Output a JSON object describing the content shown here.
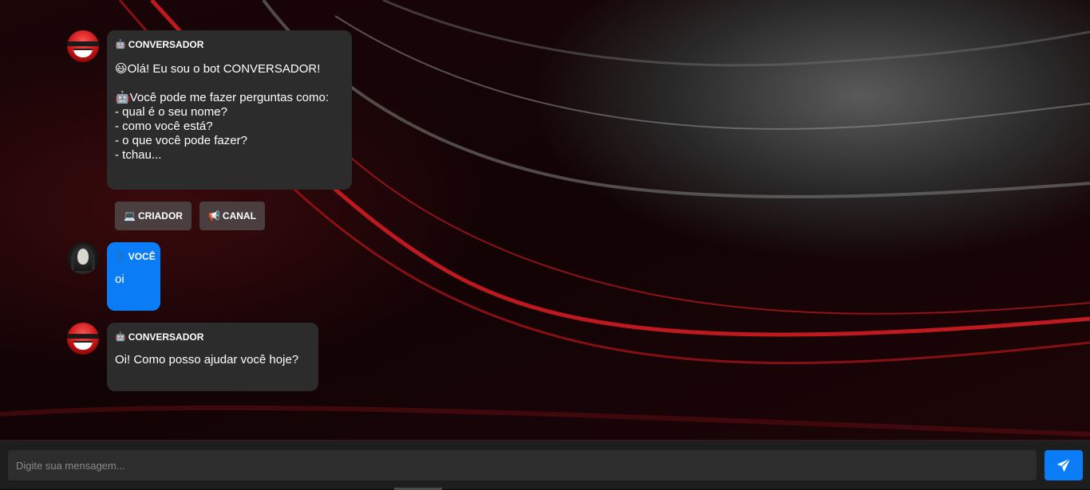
{
  "messages": [
    {
      "role": "bot",
      "sender": "CONVERSADOR",
      "sender_icon": "🤖",
      "text_lines": [
        "😃Olá! Eu sou o bot CONVERSADOR!",
        "",
        "🤖Você pode me fazer perguntas como:",
        "- qual é o seu nome?",
        "- como você está?",
        "- o que você pode fazer?",
        "- tchau..."
      ]
    },
    {
      "role": "user",
      "sender": "VOCÊ",
      "sender_icon": "👤",
      "text": "oi"
    },
    {
      "role": "bot",
      "sender": "CONVERSADOR",
      "sender_icon": "🤖",
      "text": "Oi! Como posso ajudar você hoje?"
    }
  ],
  "actions": [
    {
      "icon": "💻",
      "label": "CRIADOR"
    },
    {
      "icon": "📢",
      "label": "CANAL"
    }
  ],
  "composer": {
    "placeholder": "Digite sua mensagem...",
    "send_icon": "paper-plane-icon"
  },
  "colors": {
    "accent": "#0a7cf5",
    "bot_bubble": "#2c2c2c",
    "action_button": "#4a3e3f",
    "footer": "#1e1e1e"
  }
}
